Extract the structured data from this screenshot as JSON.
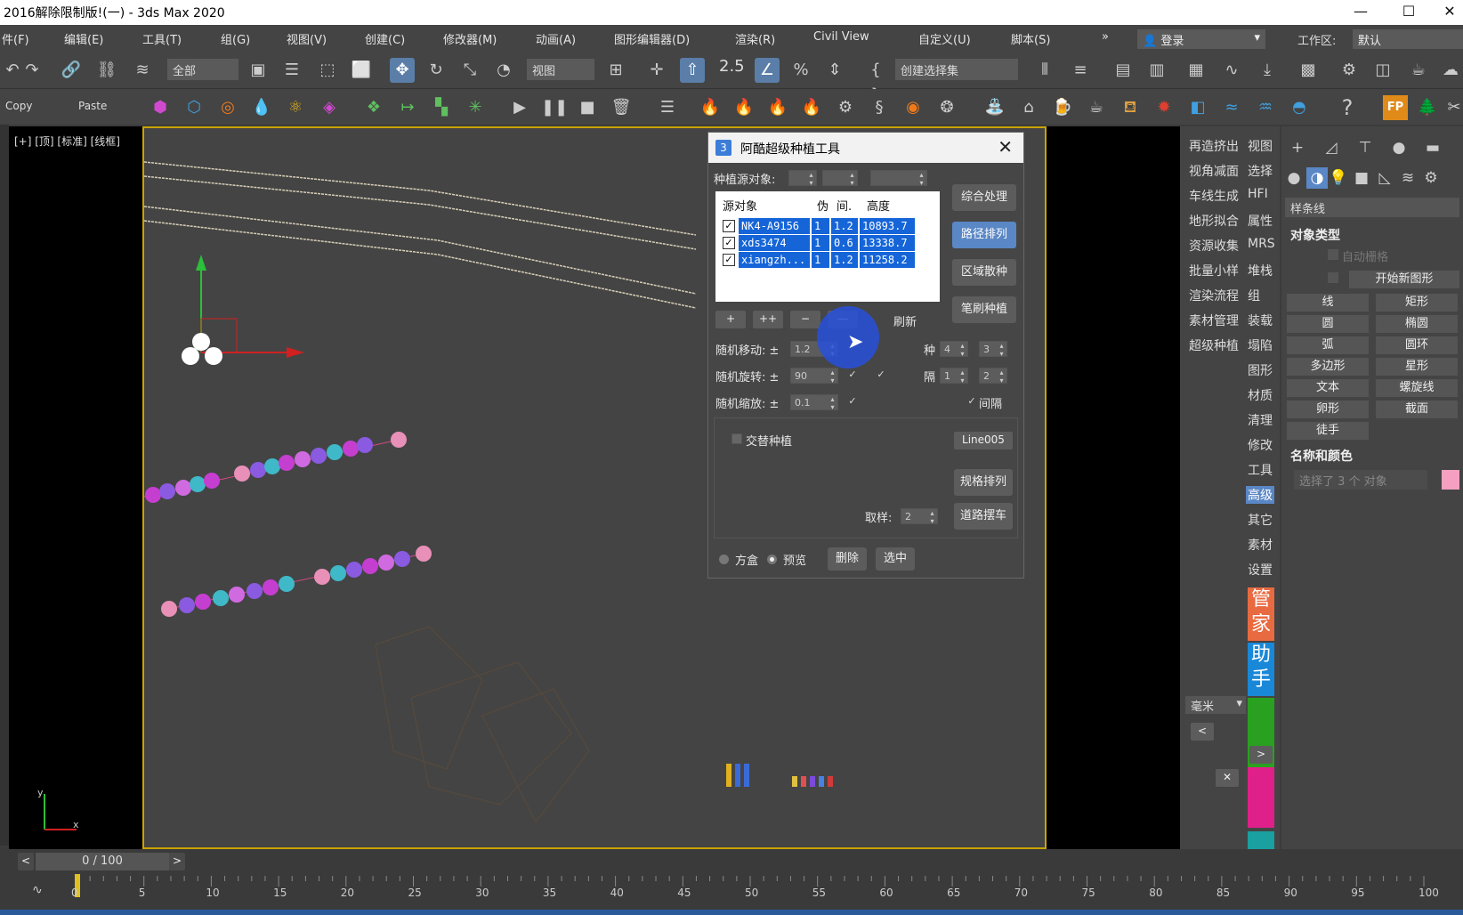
{
  "app": {
    "title": "2016解除限制版!(一) - 3ds Max 2020",
    "win_min": "—",
    "win_max": "☐",
    "win_close": "✕"
  },
  "menu": [
    "件(F)",
    "编辑(E)",
    "工具(T)",
    "组(G)",
    "视图(V)",
    "创建(C)",
    "修改器(M)",
    "动画(A)",
    "图形编辑器(D)",
    "渲染(R)",
    "Civil View",
    "自定义(U)",
    "脚本(S)"
  ],
  "menu_more": "»",
  "login": {
    "icon": "user-icon",
    "label": "登录",
    "arrow": "▾"
  },
  "workspace": {
    "label": "工作区:",
    "value": "默认"
  },
  "toolbar1": {
    "filter_select": "全部",
    "view_select": "视图",
    "snap_label": "2.5",
    "named_sel": "创建选择集"
  },
  "toolbar2": {
    "copy": "Copy",
    "paste": "Paste",
    "help": "?",
    "fp": "FP"
  },
  "viewport": {
    "label": "[+] [顶] [标准] [线框]",
    "axis_x": "x",
    "axis_y": "y"
  },
  "dialog": {
    "icon": "3",
    "title": "阿酷超级种植工具",
    "close": "✕",
    "source_label": "种植源对象:",
    "columns": [
      "源对象",
      "伪",
      "间.",
      "高度"
    ],
    "rows": [
      {
        "checked": "✓",
        "name": "NK4-A9156",
        "c1": "1",
        "c2": "1.2",
        "h": "10893.7"
      },
      {
        "checked": "✓",
        "name": "xds3474",
        "c1": "1",
        "c2": "0.6",
        "h": "13338.7"
      },
      {
        "checked": "✓",
        "name": "xiangzh...",
        "c1": "1",
        "c2": "1.2",
        "h": "11258.2"
      }
    ],
    "list_btns": [
      "+",
      "++",
      "−",
      "—"
    ],
    "refresh": "刷新",
    "side_btns": [
      "综合处理",
      "路径排列",
      "区域散种",
      "笔刷种植"
    ],
    "rand_move_label": "随机移动: ±",
    "rand_move": "1.2",
    "rand_rot_label": "随机旋转: ±",
    "rand_rot": "90",
    "rand_scale_label": "随机缩放: ±",
    "rand_scale": "0.1",
    "kind_label": "种",
    "kind_a": "4",
    "kind_b": "3",
    "gap_label": "隔",
    "gap_a": "1",
    "gap_b": "2",
    "interval_label": "间隔",
    "alt_plant_label": "交替种植",
    "line_btn": "Line005",
    "spec_btn": "规格排列",
    "road_btn": "道路摆车",
    "sample_label": "取样:",
    "sample_val": "2",
    "box_label": "方盒",
    "preview_label": "预览",
    "delete_btn": "删除",
    "select_btn": "选中",
    "check": "✓"
  },
  "right_tools": {
    "left": [
      "再造挤出",
      "视角减面",
      "车线生成",
      "地形拟合",
      "资源收集",
      "批量小样",
      "渲染流程",
      "素材管理",
      "超级种植"
    ],
    "right": [
      "视图",
      "选择",
      "HFI",
      "属性",
      "MRS",
      "堆栈",
      "组",
      "装载",
      "塌陷",
      "图形",
      "材质",
      "清理",
      "修改",
      "工具",
      "高级",
      "其它",
      "素材",
      "设置"
    ],
    "tag1": [
      "管",
      "家"
    ],
    "tag2": [
      "助",
      "手"
    ],
    "unit": "毫米",
    "prev": "<",
    "next": ">",
    "close": "✕"
  },
  "command_panel": {
    "category": "样条线",
    "object_type": "对象类型",
    "auto_grid": "自动栅格",
    "start_new": "开始新图形",
    "shapes": [
      "线",
      "矩形",
      "圆",
      "椭圆",
      "弧",
      "圆环",
      "多边形",
      "星形",
      "文本",
      "螺旋线",
      "卵形",
      "截面",
      "徒手"
    ],
    "name_color": "名称和颜色",
    "name_field": "选择了 3 个 对象",
    "swatch_color": "#f5a0c0"
  },
  "timeline": {
    "frame": "0 / 100",
    "prev": "<",
    "next": ">",
    "ticks": [
      "0",
      "5",
      "10",
      "15",
      "20",
      "25",
      "30",
      "35",
      "40",
      "45",
      "50",
      "55",
      "60",
      "65",
      "70",
      "75",
      "80",
      "85",
      "90",
      "95",
      "100"
    ]
  }
}
